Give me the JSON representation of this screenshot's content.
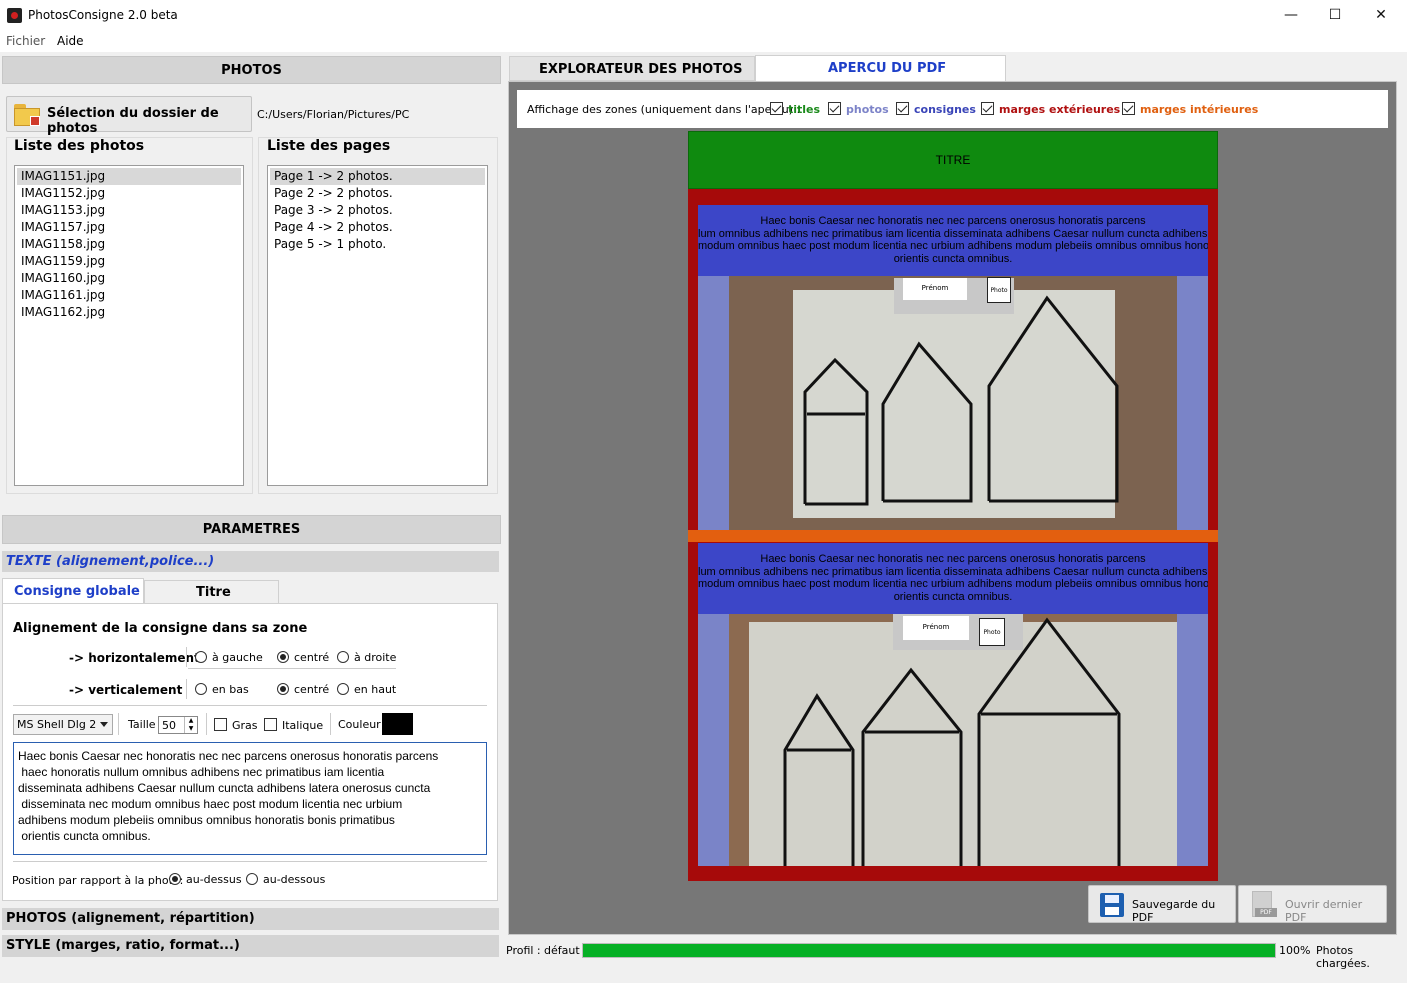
{
  "window": {
    "title": "PhotosConsigne 2.0 beta",
    "minimize": "—",
    "maximize": "☐",
    "close": "✕"
  },
  "menu": [
    "Fichier",
    "Aide"
  ],
  "photos": {
    "header": "PHOTOS",
    "select_button": "Sélection du dossier de photos",
    "folder_path": "C:/Users/Florian/Pictures/PC",
    "photos_list_title": "Liste des photos",
    "pages_list_title": "Liste des pages",
    "photos_list": [
      "IMAG1151.jpg",
      "IMAG1152.jpg",
      "IMAG1153.jpg",
      "IMAG1157.jpg",
      "IMAG1158.jpg",
      "IMAG1159.jpg",
      "IMAG1160.jpg",
      "IMAG1161.jpg",
      "IMAG1162.jpg"
    ],
    "pages_list": [
      "Page 1 -> 2 photos.",
      "Page 2 -> 2 photos.",
      "Page 3 -> 2 photos.",
      "Page 4 -> 2 photos.",
      "Page 5 -> 1 photo."
    ]
  },
  "params": {
    "header": "PARAMETRES",
    "text_section": "TEXTE (alignement,police...)",
    "tabs": [
      "Consigne globale",
      "Titre"
    ],
    "align_title": "Alignement de la consigne dans sa zone",
    "horiz_label": "-> horizontalement",
    "vert_label": "-> verticalement",
    "horiz_options": [
      "à gauche",
      "centré",
      "à droite"
    ],
    "vert_options": [
      "en bas",
      "centré",
      "en haut"
    ],
    "font_name": "MS Shell Dlg 2",
    "size_label": "Taille",
    "size_value": "50",
    "bold_label": "Gras",
    "italic_label": "Italique",
    "color_label": "Couleur",
    "text_color": "#000000",
    "consigne_text": [
      "Haec bonis Caesar nec honoratis nec nec parcens onerosus honoratis parcens",
      " haec honoratis nullum omnibus adhibens nec primatibus iam licentia",
      "disseminata adhibens Caesar nullum cuncta adhibens latera onerosus cuncta",
      " disseminata nec modum omnibus haec post modum licentia nec urbium",
      "adhibens modum plebeiis omnibus omnibus honoratis bonis primatibus",
      " orientis cuncta omnibus."
    ],
    "position_label": "Position par rapport à la photo:",
    "position_options": [
      "au-dessus",
      "au-dessous"
    ],
    "photos_section": "PHOTOS (alignement, répartition)",
    "style_section": "STYLE (marges, ratio, format...)"
  },
  "right": {
    "tabs": [
      "EXPLORATEUR DES PHOTOS",
      "APERCU DU PDF"
    ],
    "zones_label": "Affichage des zones (uniquement dans l'aperçu) :",
    "zones": [
      {
        "label": "titles",
        "color": "#1a8a1a"
      },
      {
        "label": "photos",
        "color": "#7c83c8"
      },
      {
        "label": "consignes",
        "color": "#3a45b8"
      },
      {
        "label": "marges extérieures",
        "color": "#b01010"
      },
      {
        "label": "marges intérieures",
        "color": "#e06010"
      }
    ],
    "preview": {
      "title_text": "TITRE",
      "consigne_lines": [
        "Haec bonis Caesar nec honoratis nec nec parcens onerosus honoratis parcens",
        "lum omnibus adhibens nec primatibus iam licentia disseminata adhibens Caesar nullum cuncta adhibens late",
        "modum omnibus haec post modum licentia nec urbium adhibens modum plebeiis omnibus omnibus honorati",
        "orientis cuncta omnibus."
      ],
      "name_card": "Prénom",
      "photo_card": "Photo"
    },
    "save_button": "Sauvegarde du PDF",
    "open_button": "Ouvrir dernier PDF",
    "profile_label": "Profil :",
    "profile_value": "défaut",
    "progress": 1.0,
    "progress_text": "100%",
    "status_text": "Photos chargées."
  }
}
